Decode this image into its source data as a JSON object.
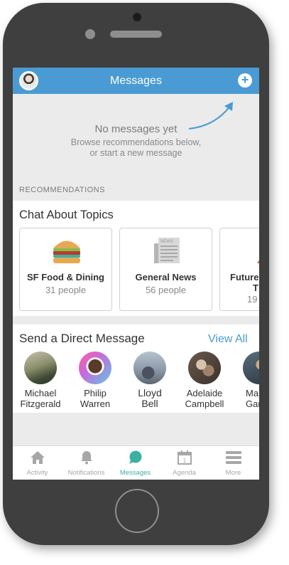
{
  "header": {
    "title": "Messages",
    "compose_icon": "compose-plus-icon",
    "avatar_icon": "user-avatar"
  },
  "empty_state": {
    "title": "No messages yet",
    "subtitle_line1": "Browse recommendations below,",
    "subtitle_line2": "or start a new message"
  },
  "recommendations_label": "RECOMMENDATIONS",
  "topics": {
    "title": "Chat About Topics",
    "cards": [
      {
        "name": "SF Food & Dining",
        "count": "31 people",
        "icon": "burger-icon"
      },
      {
        "name": "General News",
        "count": "56 people",
        "icon": "newspaper-icon"
      },
      {
        "name": "Future",
        "name2": "T",
        "count": "19",
        "icon": "triangle-icon"
      }
    ]
  },
  "direct": {
    "title": "Send a Direct Message",
    "view_all": "View All",
    "contacts": [
      {
        "line1": "Michael",
        "line2": "Fitzgerald"
      },
      {
        "line1": "Philip",
        "line2": "Warren"
      },
      {
        "line1": "Lloyd",
        "line2": "Bell"
      },
      {
        "line1": "Adelaide",
        "line2": "Campbell"
      },
      {
        "line1": "Ma",
        "line2": "Gar"
      }
    ]
  },
  "tabs": [
    {
      "label": "Activity",
      "icon": "home-icon"
    },
    {
      "label": "Notifications",
      "icon": "bell-icon"
    },
    {
      "label": "Messages",
      "icon": "chat-bubble-icon",
      "active": true
    },
    {
      "label": "Agenda",
      "icon": "calendar-icon",
      "day": "1"
    },
    {
      "label": "More",
      "icon": "menu-icon"
    }
  ],
  "colors": {
    "header": "#4a9bd3",
    "accent": "#3bb1a3",
    "link": "#4a9bd3",
    "phone": "#3f3f3f"
  }
}
